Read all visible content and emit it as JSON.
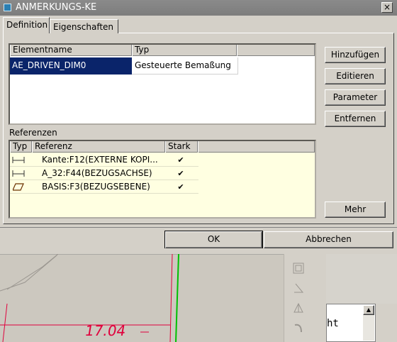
{
  "window": {
    "title": "ANMERKUNGS-KE",
    "close_symbol": "×"
  },
  "tabs": [
    {
      "label": "Definition",
      "active": true
    },
    {
      "label": "Eigenschaften",
      "active": false
    }
  ],
  "elements_table": {
    "headers": [
      "Elementname",
      "Typ"
    ],
    "rows": [
      {
        "name": "AE_DRIVEN_DIM0",
        "type": "Gesteuerte Bemaßung",
        "selected": true
      }
    ]
  },
  "side_buttons": {
    "add": "Hinzufügen",
    "edit": "Editieren",
    "parameter": "Parameter",
    "remove": "Entfernen",
    "more": "Mehr"
  },
  "references": {
    "label": "Referenzen",
    "headers": [
      "Typ",
      "Referenz",
      "Stark"
    ],
    "rows": [
      {
        "icon": "edge-dimension-icon",
        "name": "Kante:F12(EXTERNE KOPI...",
        "strong": true
      },
      {
        "icon": "axis-dimension-icon",
        "name": "A_32:F44(BEZUGSACHSE)",
        "strong": true
      },
      {
        "icon": "datum-plane-icon",
        "name": "BASIS:F3(BEZUGSEBENE)",
        "strong": true
      }
    ]
  },
  "footer": {
    "ok": "OK",
    "cancel": "Abbrechen"
  },
  "background": {
    "dimension_value": "17.04",
    "text_fragment": "ht"
  },
  "colors": {
    "selection": "#0a246a",
    "ref_area": "#ffffe1",
    "dimension": "#e0003c",
    "green_line": "#00c000"
  }
}
